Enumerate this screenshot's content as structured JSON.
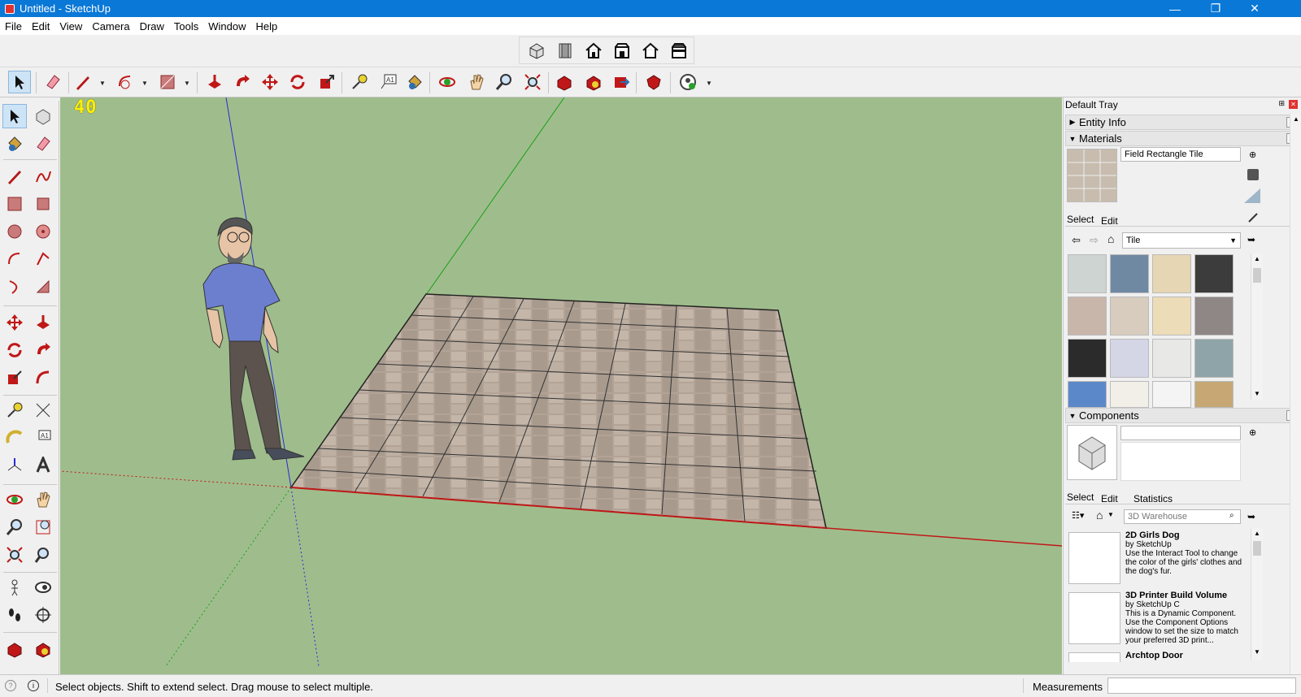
{
  "window": {
    "title": "Untitled - SketchUp",
    "minimize": "—",
    "maximize": "❐",
    "close": "✕"
  },
  "menu": [
    "File",
    "Edit",
    "View",
    "Camera",
    "Draw",
    "Tools",
    "Window",
    "Help"
  ],
  "viewport": {
    "fov_label": "40"
  },
  "tray": {
    "title": "Default Tray",
    "entity_info": {
      "label": "Entity Info",
      "expanded": false
    },
    "materials": {
      "label": "Materials",
      "name_value": "Field Rectangle Tile",
      "tabs": [
        "Select",
        "Edit"
      ],
      "library_selected": "Tile",
      "swatch_colors": [
        "#cdd4d1",
        "#6f89a3",
        "#e7d6b3",
        "#3c3c3c",
        "#c9b6aa",
        "#d8ccbe",
        "#ecdcb8",
        "#8f8686",
        "#2b2b2b",
        "#d4d6e6",
        "#e8e8e6",
        "#8fa4a8",
        "#5b88c9",
        "#f2efe9",
        "#f4f4f4",
        "#c7a874"
      ]
    },
    "components": {
      "label": "Components",
      "name_value": "",
      "tabs": [
        "Select",
        "Edit",
        "Statistics"
      ],
      "search_placeholder": "3D Warehouse",
      "items": [
        {
          "name": "2D Girls Dog",
          "by": "by SketchUp",
          "desc": "Use the Interact Tool to change the color of the girls' clothes and the dog's fur."
        },
        {
          "name": "3D Printer Build Volume",
          "by": "by SketchUp C",
          "desc": "This is a Dynamic Component. Use the Component Options window to set the size to match your preferred 3D print..."
        },
        {
          "name": "Archtop Door",
          "by": "",
          "desc": ""
        }
      ]
    }
  },
  "status": {
    "message": "Select objects. Shift to extend select. Drag mouse to select multiple.",
    "measurements_label": "Measurements",
    "measurements_value": ""
  },
  "colors": {
    "titlebar": "#0a78d7",
    "viewport": "#9fbd8c",
    "red_axis": "#c01818",
    "green_axis": "#1aa01a",
    "blue_axis": "#2a2ad8"
  }
}
